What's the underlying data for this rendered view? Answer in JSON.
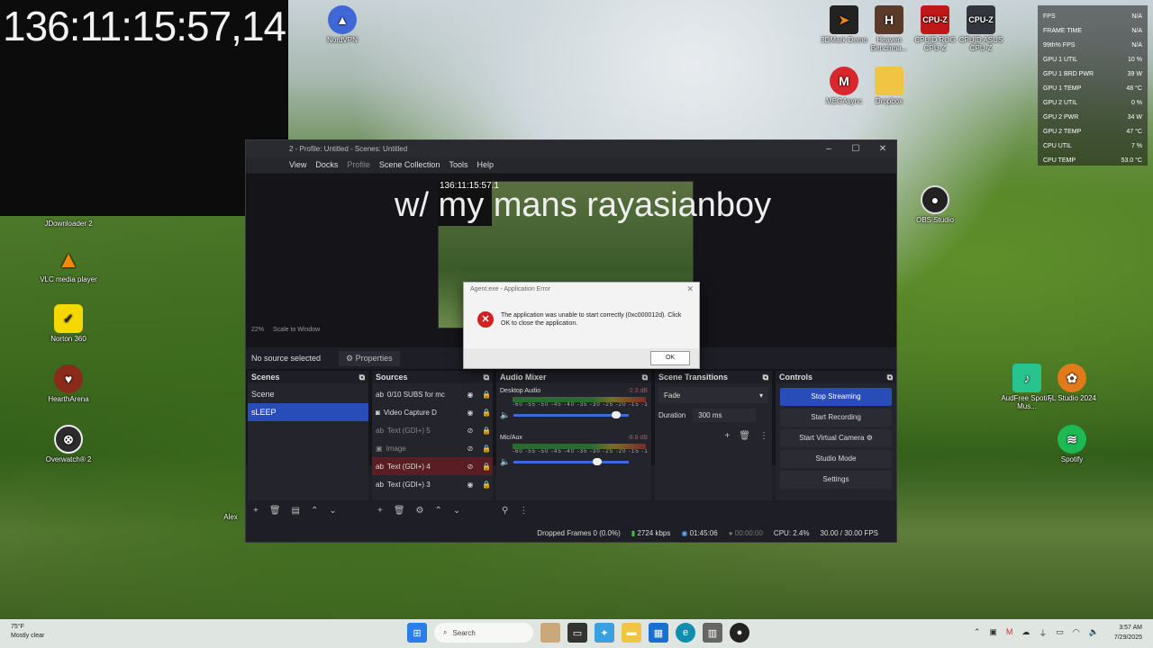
{
  "overlay_timer": "136:11:15:57,14",
  "desktop_icons": [
    {
      "label": "NordVPN"
    },
    {
      "label": "JDownloader 2"
    },
    {
      "label": "VLC media player"
    },
    {
      "label": "Norton 360"
    },
    {
      "label": "HearthArena"
    },
    {
      "label": "Overwatch® 2"
    },
    {
      "label": "Alex"
    },
    {
      "label": "3DMark Demo"
    },
    {
      "label": "Heaven Benchma..."
    },
    {
      "label": "CPUID ROG CPU-Z"
    },
    {
      "label": "CPUID ASUS CPU-Z"
    },
    {
      "label": "MEGAsync"
    },
    {
      "label": "Dropbox"
    },
    {
      "label": "OBS Studio"
    },
    {
      "label": "AudFree Spotify Mus..."
    },
    {
      "label": "FL Studio 2024"
    },
    {
      "label": "Spotify"
    }
  ],
  "stats": [
    {
      "label": "FPS",
      "value": "N/A"
    },
    {
      "label": "FRAME TIME",
      "value": "N/A"
    },
    {
      "label": "99th% FPS",
      "value": "N/A"
    },
    {
      "label": "GPU 1 UTIL",
      "value": "10 %"
    },
    {
      "label": "GPU 1 BRD PWR",
      "value": "39 W"
    },
    {
      "label": "GPU 1 TEMP",
      "value": "48 °C"
    },
    {
      "label": "GPU 2 UTIL",
      "value": "0 %"
    },
    {
      "label": "GPU 2 PWR",
      "value": "34 W"
    },
    {
      "label": "GPU 2 TEMP",
      "value": "47 °C"
    },
    {
      "label": "CPU UTIL",
      "value": "7 %"
    },
    {
      "label": "CPU TEMP",
      "value": "53.0 °C"
    }
  ],
  "obs": {
    "title": "2 - Profile: Untitled - Scenes: Untitled",
    "menu": {
      "view": "View",
      "docks": "Docks",
      "profile": "Profile",
      "scene_collection": "Scene Collection",
      "tools": "Tools",
      "help": "Help"
    },
    "preview": {
      "timer": "136:11:15:57.1",
      "overlay_text": "w/ my mans rayasianboy",
      "zoom": "22%",
      "scale": "Scale to Window"
    },
    "no_source": "No source selected",
    "properties_btn": "Properties",
    "scenes": {
      "header": "Scenes",
      "items": [
        "Scene",
        "sLEEP"
      ]
    },
    "sources": {
      "header": "Sources",
      "items": [
        {
          "name": "0/10 SUBS for mc"
        },
        {
          "name": "Video Capture D"
        },
        {
          "name": "Text (GDI+) 5"
        },
        {
          "name": "Image"
        },
        {
          "name": "Text (GDI+) 4"
        },
        {
          "name": "Text (GDI+) 3"
        }
      ]
    },
    "mixer": {
      "header": "Audio Mixer",
      "channels": [
        {
          "name": "Desktop Audio",
          "db": "-2.3 dB",
          "level": 0.92
        },
        {
          "name": "Mic/Aux",
          "db": "-8.8 dB",
          "level": 0.74
        }
      ],
      "ticks": "-60 -55 -50 -45 -40 -35 -30 -25 -20 -15 -10 -5 0"
    },
    "transitions": {
      "header": "Scene Transitions",
      "selected": "Fade",
      "duration_label": "Duration",
      "duration_value": "300 ms"
    },
    "controls": {
      "header": "Controls",
      "stop_streaming": "Stop Streaming",
      "start_recording": "Start Recording",
      "start_virtual_camera": "Start Virtual Camera",
      "studio_mode": "Studio Mode",
      "settings": "Settings"
    },
    "status": {
      "dropped": "Dropped Frames 0 (0.0%)",
      "kbps": "2724 kbps",
      "stream_time": "01:45:06",
      "rec_time": "00:00:00",
      "cpu": "CPU: 2.4%",
      "fps": "30.00 / 30.00 FPS"
    }
  },
  "error_dialog": {
    "title": "Agent.exe - Application Error",
    "message": "The application was unable to start correctly (0xc000012d). Click OK to close the application.",
    "ok": "OK"
  },
  "taskbar": {
    "temp": "75°F",
    "weather": "Mostly clear",
    "search": "Search",
    "time": "3:57 AM",
    "date": "7/29/2025"
  }
}
